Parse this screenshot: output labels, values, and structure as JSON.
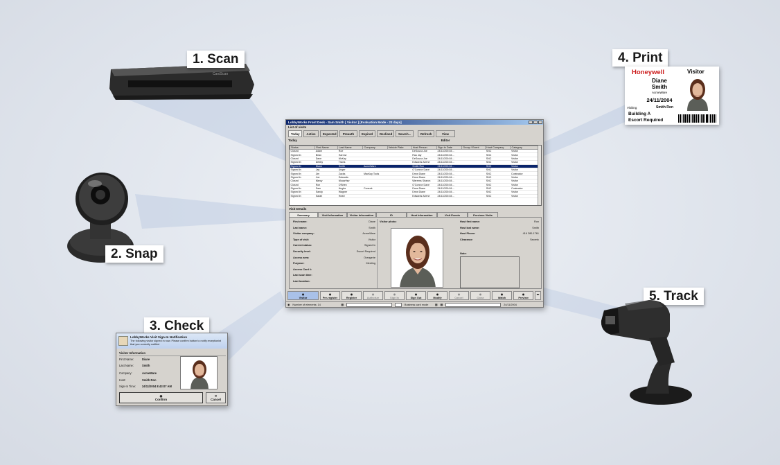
{
  "steps": {
    "scan": "1. Scan",
    "snap": "2. Snap",
    "check": "3. Check",
    "print": "4. Print",
    "track": "5. Track"
  },
  "app": {
    "title": "LobbyWorks Front Desk - Sam Smith [ Visitor ] [Evaluation Mode - 23 days]",
    "list_caption": "List of visits",
    "tabs": [
      "Today",
      "Active",
      "Expected",
      "Preauth",
      "Expired",
      "Declined",
      "Search..."
    ],
    "actions": [
      "Refresh",
      "View Editor"
    ],
    "section_title": "Today",
    "columns": [
      "Status",
      "First Name",
      "Last Name",
      "Company",
      "Vehicle Plate",
      "Host Person",
      "Sign In Date",
      "Group / Event",
      "Host Company",
      "Category"
    ],
    "rows": [
      [
        "Closed",
        "Adam",
        "Roe",
        "",
        "",
        "DeSouza Joe",
        "24/11/2004 8:...",
        "",
        "SNC",
        "Visitor"
      ],
      [
        "Signed In",
        "Brian",
        "Harrow",
        "",
        "",
        "Rau Jay",
        "24/11/2004 8:...",
        "",
        "SNC",
        "Visitor"
      ],
      [
        "Closed",
        "Dave",
        "McKay",
        "",
        "",
        "DeSouza Joe",
        "24/11/2004 8:...",
        "",
        "SNC",
        "Visitor"
      ],
      [
        "Signed In",
        "Debby",
        "Travis",
        "",
        "",
        "Edwards Arlene",
        "24/11/2004 8:...",
        "",
        "SNC",
        "Visitor"
      ],
      [
        "Signed In",
        "Diane",
        "Smith",
        "AcmeWare",
        "",
        "Smith Ron",
        "24/11/2004 8:...",
        "",
        "SNC",
        "Visitor"
      ],
      [
        "Signed In",
        "Jay",
        "Unger",
        "",
        "",
        "O'Connor Dave",
        "24/11/2004 8:...",
        "",
        "SNC",
        "Visitor"
      ],
      [
        "Signed In",
        "Jim",
        "Zacks",
        "MacKay Tools",
        "",
        "Drew Diane",
        "24/11/2004 8:...",
        "",
        "SNC",
        "Contractor"
      ],
      [
        "Signed In",
        "Joe",
        "Edwards",
        "",
        "",
        "Drew Diane",
        "24/11/2004 8:...",
        "",
        "SNC",
        "Visitor"
      ],
      [
        "Closed",
        "Marcy",
        "Mccarthur",
        "",
        "",
        "Warrens Sharon",
        "24/11/2004 8:...",
        "",
        "SNC",
        "Visitor"
      ],
      [
        "Closed",
        "Ron",
        "O'Brien",
        "",
        "",
        "O'Connor Dave",
        "24/11/2004 8:...",
        "",
        "SNC",
        "Visitor"
      ],
      [
        "Signed In",
        "Sam",
        "Hughs",
        "Comurk",
        "",
        "Drew Diane",
        "24/11/2004 8:...",
        "",
        "SNC",
        "Contractor"
      ],
      [
        "Signed In",
        "Sandy",
        "Wagner",
        "",
        "",
        "Drew Diane",
        "24/11/2004 8:...",
        "",
        "SNC",
        "Visitor"
      ],
      [
        "Signed In",
        "Sarah",
        "Heart",
        "",
        "",
        "Edwards Arlene",
        "24/11/2004 8:...",
        "",
        "SNC",
        "Visitor"
      ]
    ],
    "selected_row": 4,
    "details_caption": "Visit Details",
    "detail_tabs": [
      "Summary",
      "Visit Information",
      "Visitor Information",
      "ID",
      "Host Information",
      "Visit Events",
      "Previous Visits"
    ],
    "visitor_fields": [
      {
        "label": "First name:",
        "value": "Diane"
      },
      {
        "label": "Last name:",
        "value": "Smith"
      },
      {
        "label": "Visitor company:",
        "value": "AcmeWare"
      },
      {
        "label": "Type of visit:",
        "value": "Visitor"
      },
      {
        "label": "Current status:",
        "value": "Signed In"
      },
      {
        "label": "Security level:",
        "value": "Escort Required"
      },
      {
        "label": "Access area:",
        "value": "Orangerie"
      },
      {
        "label": "Purpose:",
        "value": "Meeting"
      },
      {
        "label": "Access Card #:",
        "value": ""
      },
      {
        "label": "Last scan time:",
        "value": ""
      },
      {
        "label": "Last location:",
        "value": ""
      }
    ],
    "photo_caption": "Visitor photo:",
    "host_fields": [
      {
        "label": "Host first name:",
        "value": "Ron"
      },
      {
        "label": "Host last name:",
        "value": "Smith"
      },
      {
        "label": "Host Phone:",
        "value": "416 280-1761"
      },
      {
        "label": "Clearance",
        "value": "Secretc"
      }
    ],
    "notes_caption": "Note:",
    "toolbar": [
      {
        "label": "Visitor",
        "icon": "visitor-icon",
        "disabled": false
      },
      {
        "label": "Pre-register",
        "icon": "preregister-icon",
        "disabled": false
      },
      {
        "label": "Register",
        "icon": "register-icon",
        "disabled": false
      },
      {
        "label": "Authorize",
        "icon": "authorize-icon",
        "disabled": true
      },
      {
        "label": "Sign In",
        "icon": "sign-in-icon",
        "disabled": true
      },
      {
        "label": "Sign Out",
        "icon": "sign-out-icon",
        "disabled": false
      },
      {
        "label": "Modify",
        "icon": "modify-icon",
        "disabled": false
      },
      {
        "label": "Cancel",
        "icon": "cancel-icon",
        "disabled": true
      },
      {
        "label": "Close",
        "icon": "close-icon",
        "disabled": true
      },
      {
        "label": "Watch",
        "icon": "watch-icon",
        "disabled": false
      },
      {
        "label": "Preview",
        "icon": "preview-icon",
        "disabled": false
      }
    ],
    "status": {
      "count_text": "Number of elements: 14",
      "mode_text": "Business card mode",
      "date_text": "24/11/2004"
    }
  },
  "badge": {
    "brand": "Honeywell",
    "type": "Visitor",
    "first_name": "Diane",
    "last_name": "Smith",
    "company": "AcmeWare",
    "date": "24/11/2004",
    "visiting_label": "Visiting",
    "host": "Smith Ron",
    "line1": "Building A",
    "line2": "Escort Required"
  },
  "dialog": {
    "title": "LobbyWorks Visit Sign-In Notification",
    "message": "The following visitor signed in now. Please confirm button to notify receptionist that you correctly notified",
    "section": "Visitor Information",
    "fields": [
      {
        "label": "First Name:",
        "value": "Diane"
      },
      {
        "label": "Last Name:",
        "value": "Smith"
      },
      {
        "label": "Company:",
        "value": "AcmeWare"
      },
      {
        "label": "Host:",
        "value": "Smith Ron"
      },
      {
        "label": "Sign-In Time:",
        "value": "24/11/2004 8:43:07 AM"
      }
    ],
    "confirm_label": "Confirm",
    "cancel_label": "Cancel"
  },
  "colors": {
    "selection": "#0a246a",
    "title_bar": "#0a246a",
    "brand_red": "#cc1b1b",
    "window_face": "#d6d3ce"
  }
}
